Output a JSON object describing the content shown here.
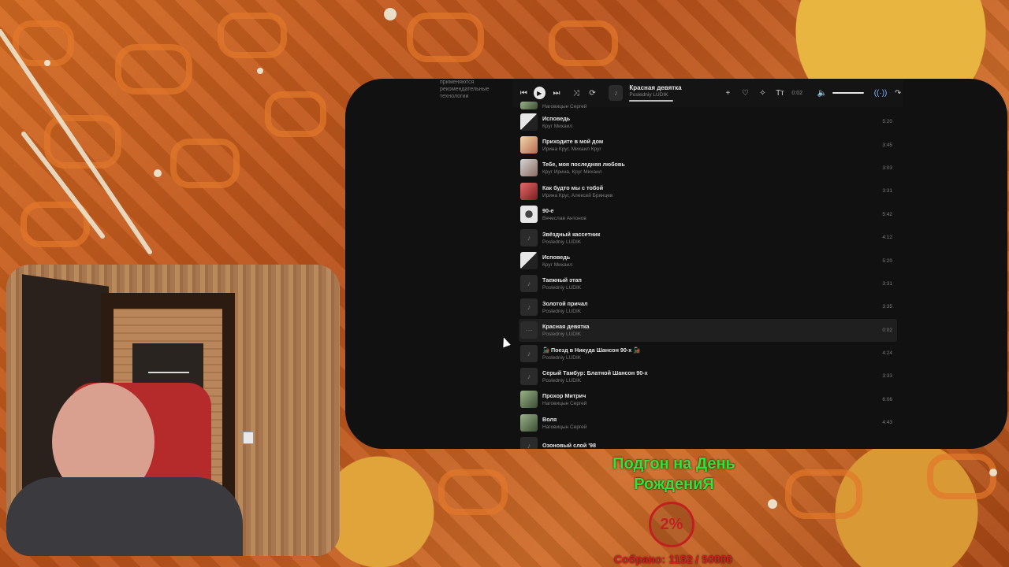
{
  "sidebar": {
    "note_line1": "применяются",
    "note_line2": "рекомендательные",
    "note_line3": "технологии"
  },
  "player": {
    "now_title": "Красная девятка",
    "now_artist": "Posledniy LUDIK",
    "time": "0:02",
    "icons": [
      "prev-icon",
      "play-icon",
      "next-icon",
      "shuffle-icon",
      "repeat-icon",
      "add-icon",
      "dislike-icon",
      "sparkle-icon",
      "text-icon",
      "volume-icon",
      "broadcast-icon",
      "share-icon"
    ]
  },
  "tracks": [
    {
      "title": "",
      "artist": "Наговицын Сергей",
      "dur": "",
      "cover": "green"
    },
    {
      "title": "Исповедь",
      "artist": "Круг Михаил",
      "dur": "5:20",
      "cover": "krug"
    },
    {
      "title": "Приходите в мой дом",
      "artist": "Ирина Круг, Михаил Круг",
      "dur": "3:45",
      "cover": "irina"
    },
    {
      "title": "Тебе, моя последняя любовь",
      "artist": "Круг Ирина, Круг Михаил",
      "dur": "3:03",
      "cover": "pair"
    },
    {
      "title": "Как будто мы с тобой",
      "artist": "Ирина Круг, Алексей Брянцев",
      "dur": "3:31",
      "cover": "red"
    },
    {
      "title": "90-е",
      "artist": "Вячеслав Антонов",
      "dur": "5:42",
      "cover": "ninety"
    },
    {
      "title": "Звёздный кассетник",
      "artist": "Posledniy LUDIK",
      "dur": "4:12",
      "cover": "empty"
    },
    {
      "title": "Исповедь",
      "artist": "Круг Михаил",
      "dur": "5:20",
      "cover": "krug"
    },
    {
      "title": "Таежный этап",
      "artist": "Posledniy LUDIK",
      "dur": "3:31",
      "cover": "empty"
    },
    {
      "title": "Золотой причал",
      "artist": "Posledniy LUDIK",
      "dur": "3:35",
      "cover": "empty"
    },
    {
      "title": "Красная девятка",
      "artist": "Posledniy LUDIK",
      "dur": "0:02",
      "cover": "empty",
      "active": true
    },
    {
      "title": "🚂 Поезд в Никуда Шансон 90-х 🚂",
      "artist": "Posledniy LUDIK",
      "dur": "4:24",
      "cover": "empty"
    },
    {
      "title": "Серый Тамбур: Блатной Шансон 90-х",
      "artist": "Posledniy LUDIK",
      "dur": "3:33",
      "cover": "empty"
    },
    {
      "title": "Прохор Митрич",
      "artist": "Наговицын Сергей",
      "dur": "6:06",
      "cover": "green"
    },
    {
      "title": "Воля",
      "artist": "Наговицын Сергей",
      "dur": "4:43",
      "cover": "green"
    },
    {
      "title": "Озоновый слой '98",
      "artist": "",
      "dur": "",
      "cover": "empty"
    }
  ],
  "donation": {
    "title": "Подгон на День РождениЯ",
    "percent": "2%",
    "progress": 0.023,
    "collected": "Собрано: 1152 / 50000"
  },
  "colors": {
    "window_bg": "#111112",
    "donate_title": "#35e23a",
    "donate_red": "#c21f1f"
  }
}
